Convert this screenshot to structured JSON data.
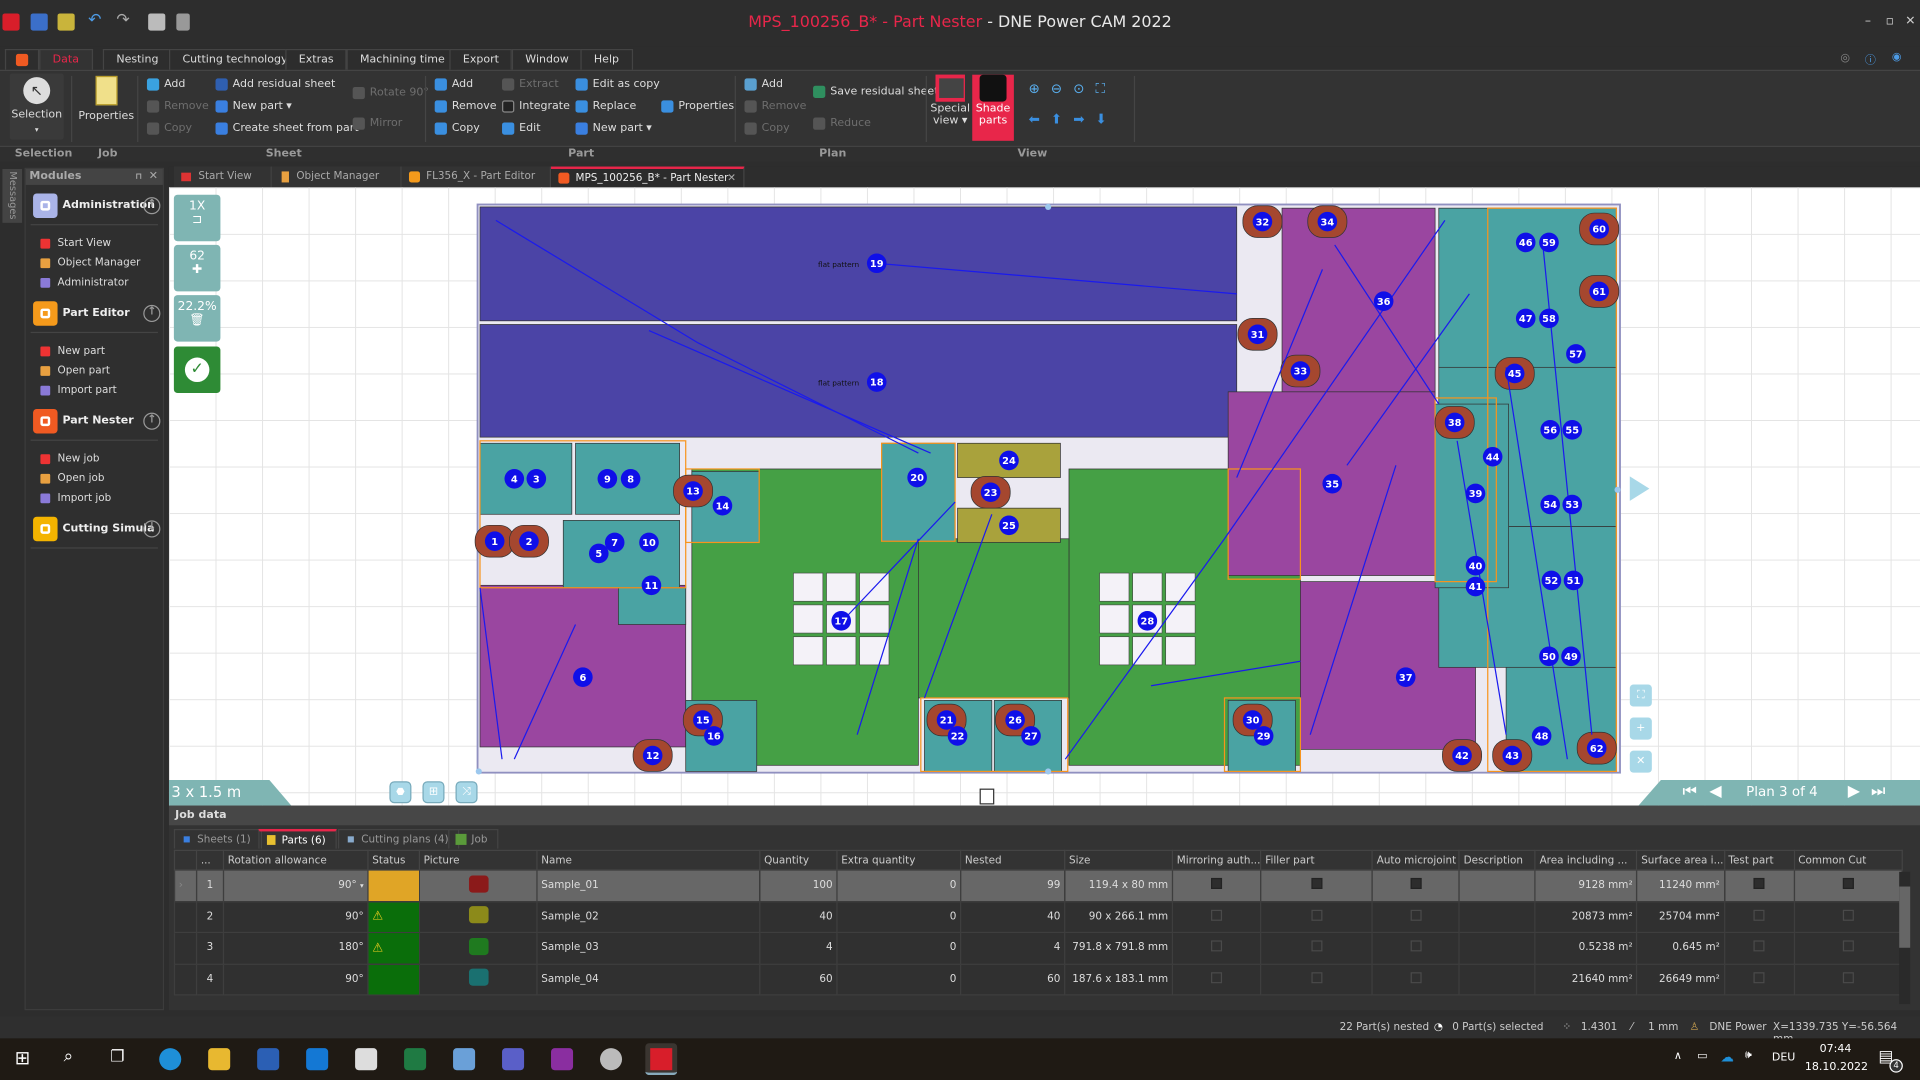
{
  "window": {
    "title_doc": "MPS_100256_B* - Part Nester",
    "title_sep": " - ",
    "title_app": "DNE Power CAM 2022",
    "min": "–",
    "max": "▫",
    "close": "✕"
  },
  "ribbon": {
    "tabs": [
      "Data",
      "Nesting",
      "Cutting technology",
      "Extras",
      "Machining time",
      "Export",
      "Window",
      "Help"
    ],
    "active_tab": "Data",
    "selection": {
      "label": "Selection",
      "dropdown": "▾"
    },
    "job": {
      "properties": "Properties"
    },
    "sheet": {
      "add": "Add",
      "remove": "Remove",
      "copy": "Copy",
      "add_residual": "Add residual sheet",
      "new_part": "New part ▾",
      "create_from_part": "Create sheet from part",
      "rotate": "Rotate 90°",
      "mirror": "Mirror"
    },
    "part": {
      "add": "Add",
      "remove": "Remove",
      "copy": "Copy",
      "extract": "Extract",
      "integrate": "Integrate",
      "edit": "Edit",
      "edit_as_copy": "Edit as copy",
      "replace": "Replace",
      "new_part": "New part ▾",
      "properties": "Properties"
    },
    "plan": {
      "add": "Add",
      "remove": "Remove",
      "copy": "Copy",
      "save_residual": "Save residual sheet",
      "reduce": "Reduce"
    },
    "view": {
      "special_view": "Special view ▾",
      "shade_parts": "Shade parts"
    },
    "groups": [
      "Selection",
      "Job",
      "Sheet",
      "Part",
      "Plan",
      "View"
    ],
    "accent": "#e8264a"
  },
  "messages_tab": "Messages",
  "modules": {
    "title": "Modules",
    "pin": "⊓",
    "close": "✕",
    "groups": [
      {
        "name": "Administration",
        "color": "#aab4e8",
        "items": [
          "Start View",
          "Object Manager",
          "Administrator"
        ],
        "arrow": "↑"
      },
      {
        "name": "Part Editor",
        "color": "#f59a1b",
        "items": [
          "New part",
          "Open part",
          "Import part"
        ],
        "arrow": "↑"
      },
      {
        "name": "Part Nester",
        "color": "#f05a22",
        "items": [
          "New job",
          "Open job",
          "Import job"
        ],
        "arrow": "↑"
      },
      {
        "name": "Cutting Simula",
        "color": "#f4b400",
        "items": [],
        "arrow": "↓"
      }
    ]
  },
  "doc_tabs": [
    {
      "label": "Start View",
      "active": false
    },
    {
      "label": "Object Manager",
      "active": false
    },
    {
      "label": "FL356_X - Part Editor",
      "active": false
    },
    {
      "label": "MPS_100256_B* - Part Nester",
      "active": true,
      "close": "✕"
    }
  ],
  "canvas": {
    "tiles": [
      {
        "value": "1X",
        "icon": "sheet-icon"
      },
      {
        "value": "62",
        "icon": "puzzle-icon"
      },
      {
        "value": "22.2%",
        "icon": "trash-icon"
      }
    ],
    "sheet_size": "3 x 1.5 m",
    "plan_nav": "Plan 3 of 4",
    "flat_pattern": "flat pattern",
    "part_labels": [
      "1",
      "2",
      "3",
      "4",
      "5",
      "6",
      "7",
      "8",
      "9",
      "10",
      "11",
      "12",
      "13",
      "14",
      "15",
      "16",
      "17",
      "18",
      "19",
      "20",
      "21",
      "22",
      "23",
      "24",
      "25",
      "26",
      "27",
      "28",
      "29",
      "30",
      "31",
      "32",
      "33",
      "34",
      "35",
      "36",
      "37",
      "38",
      "39",
      "40",
      "41",
      "42",
      "43",
      "44",
      "45",
      "46",
      "47",
      "48",
      "49",
      "50",
      "51",
      "52",
      "53",
      "54",
      "55",
      "56",
      "57",
      "58",
      "59",
      "60",
      "61",
      "62"
    ],
    "colors": {
      "blue": "#4b44a6",
      "purple": "#9a46a0",
      "green": "#45a045",
      "teal": "#4aa3a3",
      "brown": "#a5472f",
      "yellow": "#a9a23c",
      "label": "#0f0fe8",
      "frame": "#f7941d"
    }
  },
  "job_data": {
    "title": "Job data",
    "tabs": [
      {
        "label": "Sheets (1)",
        "active": false
      },
      {
        "label": "Parts (6)",
        "active": true
      },
      {
        "label": "Cutting plans (4)",
        "active": false
      },
      {
        "label": "Job",
        "active": false
      }
    ],
    "columns": [
      "...",
      "Rotation allowance",
      "Status",
      "Picture",
      "Name",
      "Quantity",
      "Extra quantity",
      "Nested",
      "Size",
      "Mirroring auth...",
      "Filler part",
      "Auto microjoint",
      "Description",
      "Area including ...",
      "Surface area i...",
      "Test part",
      "Common Cut"
    ],
    "rows": [
      {
        "idx": "1",
        "rotation": "90°",
        "status": "#e0a526",
        "warn": false,
        "pic": "#8b1a1a",
        "name": "Sample_01",
        "quantity": "100",
        "extra": "0",
        "nested": "99",
        "size": "119.4 x 80 mm",
        "area": "9128 mm²",
        "surface": "11240 mm²",
        "selected": true
      },
      {
        "idx": "2",
        "rotation": "90°",
        "status": "#0a6e0a",
        "warn": true,
        "pic": "#8c8a1a",
        "name": "Sample_02",
        "quantity": "40",
        "extra": "0",
        "nested": "40",
        "size": "90 x 266.1 mm",
        "area": "20873 mm²",
        "surface": "25704 mm²",
        "selected": false
      },
      {
        "idx": "3",
        "rotation": "180°",
        "status": "#0a6e0a",
        "warn": true,
        "pic": "#1f7a1f",
        "name": "Sample_03",
        "quantity": "4",
        "extra": "0",
        "nested": "4",
        "size": "791.8 x 791.8 mm",
        "area": "0.5238 m²",
        "surface": "0.645 m²",
        "selected": false
      },
      {
        "idx": "4",
        "rotation": "90°",
        "status": "#0a6e0a",
        "warn": false,
        "pic": "#1a7070",
        "name": "Sample_04",
        "quantity": "60",
        "extra": "0",
        "nested": "60",
        "size": "187.6 x 183.1 mm",
        "area": "21640 mm²",
        "surface": "26649 mm²",
        "selected": false
      }
    ]
  },
  "status_bar": {
    "nested": "22 Part(s) nested",
    "selected": "0 Part(s) selected",
    "factor": "1.4301",
    "tool": "1 mm",
    "user": "DNE Power",
    "coords": "X=1339.735  Y=-56.564 mm"
  },
  "taskbar": {
    "lang": "DEU",
    "time": "07:44",
    "date": "18.10.2022",
    "notifications": "4"
  }
}
